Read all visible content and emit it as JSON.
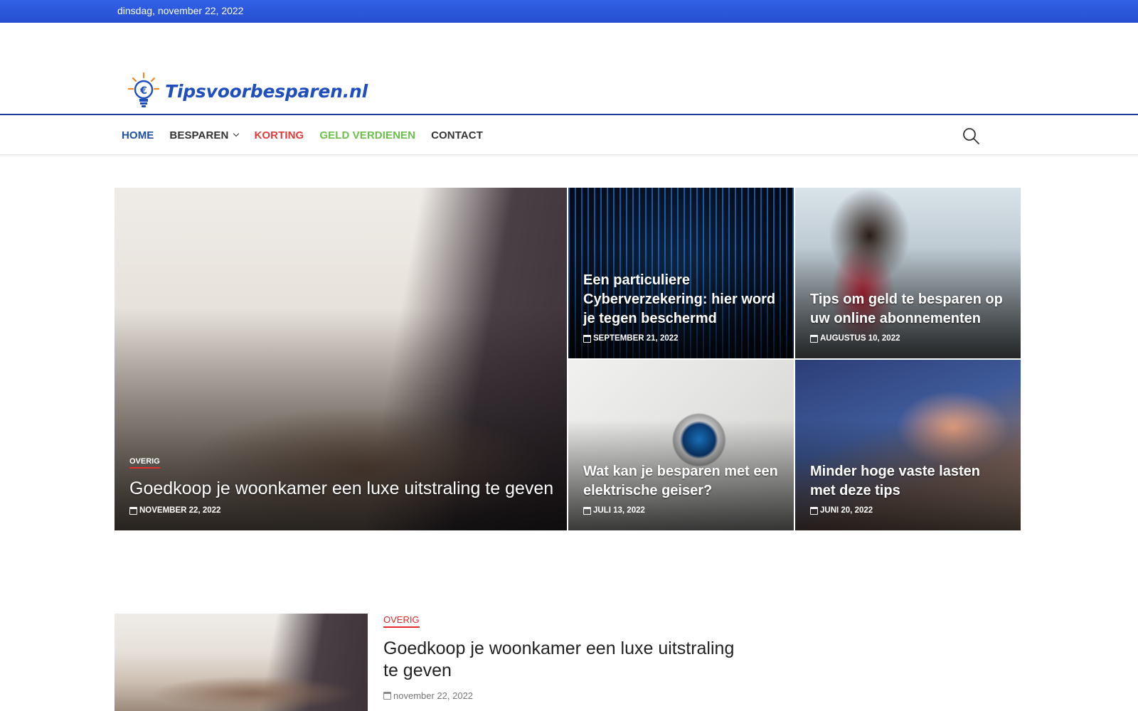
{
  "topbar": {
    "date": "dinsdag, november 22, 2022"
  },
  "site": {
    "name": "Tipsvoorbesparen.nl",
    "logo_icon": "lightbulb-euro-icon",
    "accent": "#1f4fbf"
  },
  "nav": {
    "items": [
      {
        "label": "HOME",
        "color": "#1f4fa8"
      },
      {
        "label": "BESPAREN",
        "color": "#333333",
        "has_dropdown": true
      },
      {
        "label": "KORTING",
        "color": "#e03a3a"
      },
      {
        "label": "GELD VERDIENEN",
        "color": "#6cc04a"
      },
      {
        "label": "CONTACT",
        "color": "#333333"
      }
    ],
    "search_icon": "search-icon"
  },
  "featured": {
    "main": {
      "category": "OVERIG",
      "title": "Goedkoop je woonkamer een luxe uitstraling te geven",
      "date": "NOVEMBER 22, 2022"
    },
    "tiles": [
      {
        "title": "Een particuliere Cyberverzekering: hier word je tegen beschermd",
        "date": "SEPTEMBER 21, 2022"
      },
      {
        "title": "Tips om geld te besparen op uw online abonnementen",
        "date": "AUGUSTUS 10, 2022"
      },
      {
        "title": "Wat kan je besparen met een elektrische geiser?",
        "date": "JULI 13, 2022"
      },
      {
        "title": "Minder hoge vaste lasten met deze tips",
        "date": "JUNI 20, 2022"
      }
    ]
  },
  "post": {
    "category": "OVERIG",
    "title": "Goedkoop je woonkamer een luxe uitstraling te geven",
    "date": "november 22, 2022"
  }
}
